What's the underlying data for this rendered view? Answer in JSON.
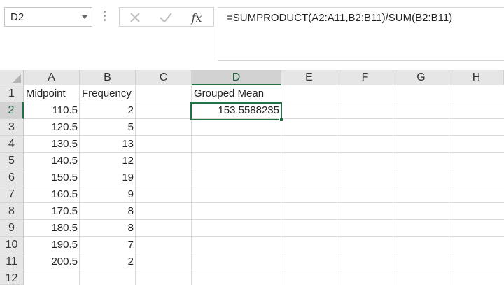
{
  "formula_bar": {
    "name_box": "D2",
    "formula": "=SUMPRODUCT(A2:A11,B2:B11)/SUM(B2:B11)",
    "fx_label": "fx"
  },
  "sheet": {
    "columns": [
      "A",
      "B",
      "C",
      "D",
      "E",
      "F",
      "G",
      "H"
    ],
    "rows": [
      "1",
      "2",
      "3",
      "4",
      "5",
      "6",
      "7",
      "8",
      "9",
      "10",
      "11",
      "12"
    ],
    "selected_column": "D",
    "selected_row": "2",
    "headers": {
      "a1": "Midpoint",
      "b1": "Frequency",
      "d1": "Grouped Mean"
    },
    "midpoints": [
      "110.5",
      "120.5",
      "130.5",
      "140.5",
      "150.5",
      "160.5",
      "170.5",
      "180.5",
      "190.5",
      "200.5"
    ],
    "frequencies": [
      "2",
      "5",
      "13",
      "12",
      "19",
      "9",
      "8",
      "8",
      "7",
      "2"
    ],
    "d2": "153.5588235"
  },
  "colors": {
    "accent": "#217346",
    "header_bg": "#e6e6e6",
    "gridline": "#dadada"
  }
}
